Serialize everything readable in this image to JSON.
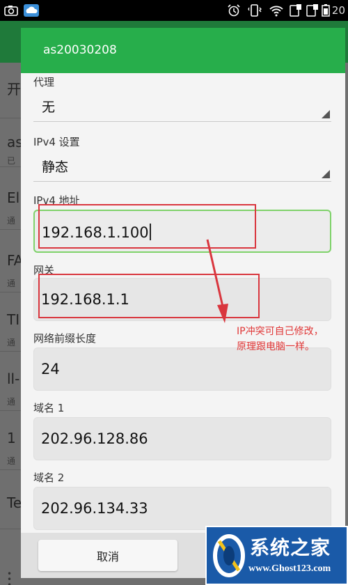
{
  "status_bar": {
    "time": "20",
    "icons": [
      "screenshot-icon",
      "weather-icon",
      "alarm-icon",
      "vibrate-icon",
      "wifi-icon",
      "sim1-icon",
      "sim2-icon",
      "battery-icon"
    ]
  },
  "background_list": {
    "letters": [
      "开",
      "as",
      "El",
      "FA",
      "TI",
      "ll-",
      "1",
      "Te"
    ],
    "subs": [
      "已",
      "通",
      "通",
      "通",
      "通",
      "通"
    ]
  },
  "dialog": {
    "title": "as20030208",
    "proxy": {
      "label": "代理",
      "value": "无"
    },
    "ipv4_settings": {
      "label": "IPv4 设置",
      "value": "静态"
    },
    "ipv4_address": {
      "label": "IPv4 地址",
      "value": "192.168.1.100"
    },
    "gateway": {
      "label": "网关",
      "value": "192.168.1.1"
    },
    "prefix_length": {
      "label": "网络前缀长度",
      "value": "24"
    },
    "dns1": {
      "label": "域名 1",
      "value": "202.96.128.86"
    },
    "dns2": {
      "label": "域名 2",
      "value": "202.96.134.33"
    },
    "cancel_label": "取消"
  },
  "annotation": {
    "line1": "IP冲突可自己修改，",
    "line2": "原理跟电脑一样。",
    "color": "#e03535"
  },
  "watermark": {
    "chinese": "系统之家",
    "url": "www.Ghost123.com"
  },
  "colors": {
    "accent_green": "#27ae4b",
    "focus_border": "#7fd26a",
    "highlight_red": "#d9363e",
    "watermark_blue": "#1a5aa8"
  }
}
